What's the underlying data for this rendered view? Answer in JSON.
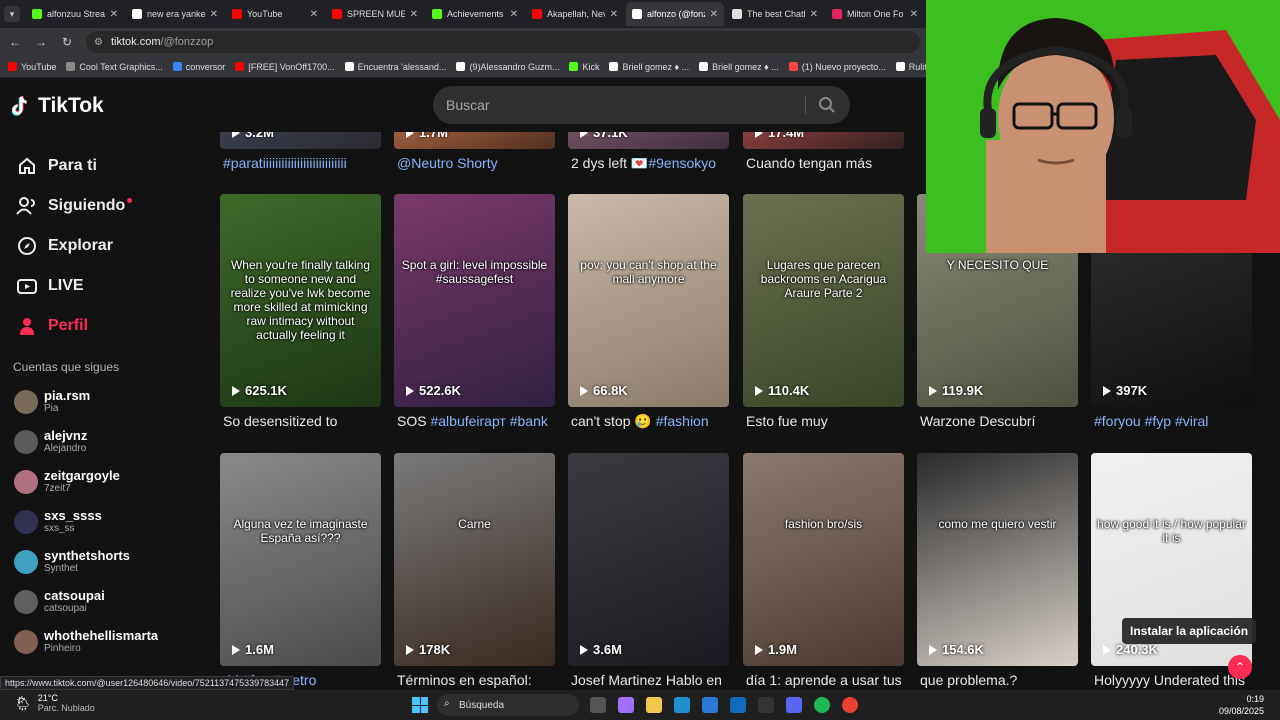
{
  "browser": {
    "tabs": [
      {
        "title": "alfonzuu Strea",
        "color": "#53fc18",
        "active": false
      },
      {
        "title": "new era yankee",
        "color": "#ffffff",
        "active": false
      },
      {
        "title": "YouTube",
        "color": "#ff0000",
        "active": false
      },
      {
        "title": "SPREEN MUES",
        "color": "#ff0000",
        "active": false
      },
      {
        "title": "Achievements",
        "color": "#53fc18",
        "active": false
      },
      {
        "title": "Akapellah, Nev",
        "color": "#ff0000",
        "active": false
      },
      {
        "title": "alfonzo (@fonz",
        "color": "#ffffff",
        "active": true
      },
      {
        "title": "The best Chatb",
        "color": "#dddddd",
        "active": false
      },
      {
        "title": "Milton One Fo",
        "color": "#e0245e",
        "active": false
      }
    ],
    "address": {
      "host": "tiktok.com",
      "path": "/@fonzzop"
    },
    "bookmarks": [
      {
        "label": "YouTube",
        "color": "#ff0000"
      },
      {
        "label": "Cool Text Graphics...",
        "color": "#888888"
      },
      {
        "label": "conversor",
        "color": "#3b82f6"
      },
      {
        "label": "[FREE] VonOff1700...",
        "color": "#ff0000"
      },
      {
        "label": "Encuentra 'alessand...",
        "color": "#ffffff"
      },
      {
        "label": "(9)Alessandro Guzm...",
        "color": "#ffffff"
      },
      {
        "label": "Kick",
        "color": "#53fc18"
      },
      {
        "label": "Briell gomez ♦ ...",
        "color": "#ffffff"
      },
      {
        "label": "Briell gomez ♦ ...",
        "color": "#ffffff"
      },
      {
        "label": "(1) Nuevo proyecto...",
        "color": "#ff4444"
      },
      {
        "label": "Rulitos",
        "color": "#ffffff"
      }
    ],
    "status_url": "https://www.tiktok.com/@user126480646/video/7521137475339783447"
  },
  "tiktok": {
    "brand": "TikTok",
    "search_placeholder": "Buscar",
    "accent": "#fe2c55",
    "nav": [
      {
        "label": "Para ti",
        "icon": "home-icon",
        "active": false
      },
      {
        "label": "Siguiendo",
        "icon": "following-icon",
        "active": false
      },
      {
        "label": "Explorar",
        "icon": "compass-icon",
        "active": false
      },
      {
        "label": "LIVE",
        "icon": "live-icon",
        "active": false
      },
      {
        "label": "Perfil",
        "icon": "profile-icon",
        "active": true
      }
    ],
    "following_title": "Cuentas que sigues",
    "following": [
      {
        "name": "pia.rsm",
        "sub": "Pia",
        "color": "#7a6a5a"
      },
      {
        "name": "alejvnz",
        "sub": "Alejandro",
        "color": "#5a5a5a"
      },
      {
        "name": "zeitgargoyle",
        "sub": "7zeit7",
        "color": "#b07080"
      },
      {
        "name": "sxs_ssss",
        "sub": "sxs_ss",
        "color": "#303050"
      },
      {
        "name": "synthetshorts",
        "sub": "Synthet",
        "color": "#40a0c0"
      },
      {
        "name": "catsoupai",
        "sub": "catsoupai",
        "color": "#606060"
      },
      {
        "name": "whothehellismarta",
        "sub": "Pinheiro",
        "color": "#806050"
      }
    ],
    "top_row": [
      {
        "views": "3.2M",
        "caption": "",
        "tags": "#paratiiiiiiiiiiiiiiiiiiiiiiiiiii",
        "c1": "#3a4050",
        "c2": "#2a2a30"
      },
      {
        "views": "1.7M",
        "caption": "",
        "tags": "@Neutro Shorty",
        "c1": "#a06040",
        "c2": "#503020"
      },
      {
        "views": "37.1K",
        "caption": "2 dys left 💌",
        "tags": "#9ensokyo",
        "c1": "#705060",
        "c2": "#403040"
      },
      {
        "views": "17.4M",
        "caption": "Cuando tengan más",
        "tags": "",
        "c1": "#904040",
        "c2": "#302020"
      }
    ],
    "row1": [
      {
        "views": "625.1K",
        "caption": "So desensitized to",
        "tags": "",
        "overlay": "When you're finally talking to someone new and realize you've lwk become more skilled at mimicking raw intimacy without actually feeling it",
        "c1": "#3f6a2a",
        "c2": "#1d3515"
      },
      {
        "views": "522.6K",
        "caption": "SOS ",
        "tags": "#albufeiraрт #bank",
        "overlay": "Spot a girl: level impossible #saussagefest",
        "c1": "#7a3a6a",
        "c2": "#302040"
      },
      {
        "views": "66.8K",
        "caption": "can't stop 🥲 ",
        "tags": "#fashion",
        "overlay": "pov: you can't shop at the mall anymore",
        "c1": "#c9b9a8",
        "c2": "#8a7a6a"
      },
      {
        "views": "110.4K",
        "caption": "Esto fue muy",
        "tags": "",
        "overlay": "Lugares que parecen backrooms en Acarigua Araure Parte 2",
        "c1": "#6a7050",
        "c2": "#3a4528"
      },
      {
        "views": "119.9K",
        "caption": "Warzone Descubrí",
        "tags": "",
        "overlay": "Y NECESITO QUE",
        "c1": "#8a8a78",
        "c2": "#505040"
      },
      {
        "views": "397K",
        "caption": "",
        "tags": "#foryou #fyp #viral",
        "overlay": "",
        "c1": "#303030",
        "c2": "#101010"
      }
    ],
    "row2": [
      {
        "views": "1.6M",
        "caption": "",
        "tags": "rid #fyp #metro",
        "overlay": "Alguna vez te imaginaste España así???",
        "c1": "#8a8a8a",
        "c2": "#4a4a4a"
      },
      {
        "views": "178K",
        "caption": "Términos en español:",
        "tags": "",
        "overlay": "Carne",
        "c1": "#7a7a7a",
        "c2": "#3a2a20"
      },
      {
        "views": "3.6M",
        "caption": "Josef Martinez Hablo en",
        "tags": "",
        "overlay": "",
        "c1": "#3a3a40",
        "c2": "#1a1a20"
      },
      {
        "views": "1.9M",
        "caption": "día 1: aprende a usar tus",
        "tags": "",
        "overlay": "fashion bro/sis",
        "c1": "#8a7a70",
        "c2": "#4a3a30"
      },
      {
        "views": "154.6K",
        "caption": "que problema.?",
        "tags": "",
        "overlay": "como me quiero vestir",
        "c1": "#2a2a2a",
        "c2": "#d8d0c8"
      },
      {
        "views": "240.3K",
        "caption": "Holyyyyy Underated this",
        "tags": "",
        "overlay": "how good it is / how popular it is",
        "c1": "#f0f0f0",
        "c2": "#e0e0e0"
      }
    ],
    "install_label": "Instalar la aplicación"
  },
  "taskbar": {
    "temp": "21°C",
    "weather": "Parc. Nublado",
    "search": "Búsqueda",
    "time": "0:19",
    "date": "09/08/2025"
  }
}
